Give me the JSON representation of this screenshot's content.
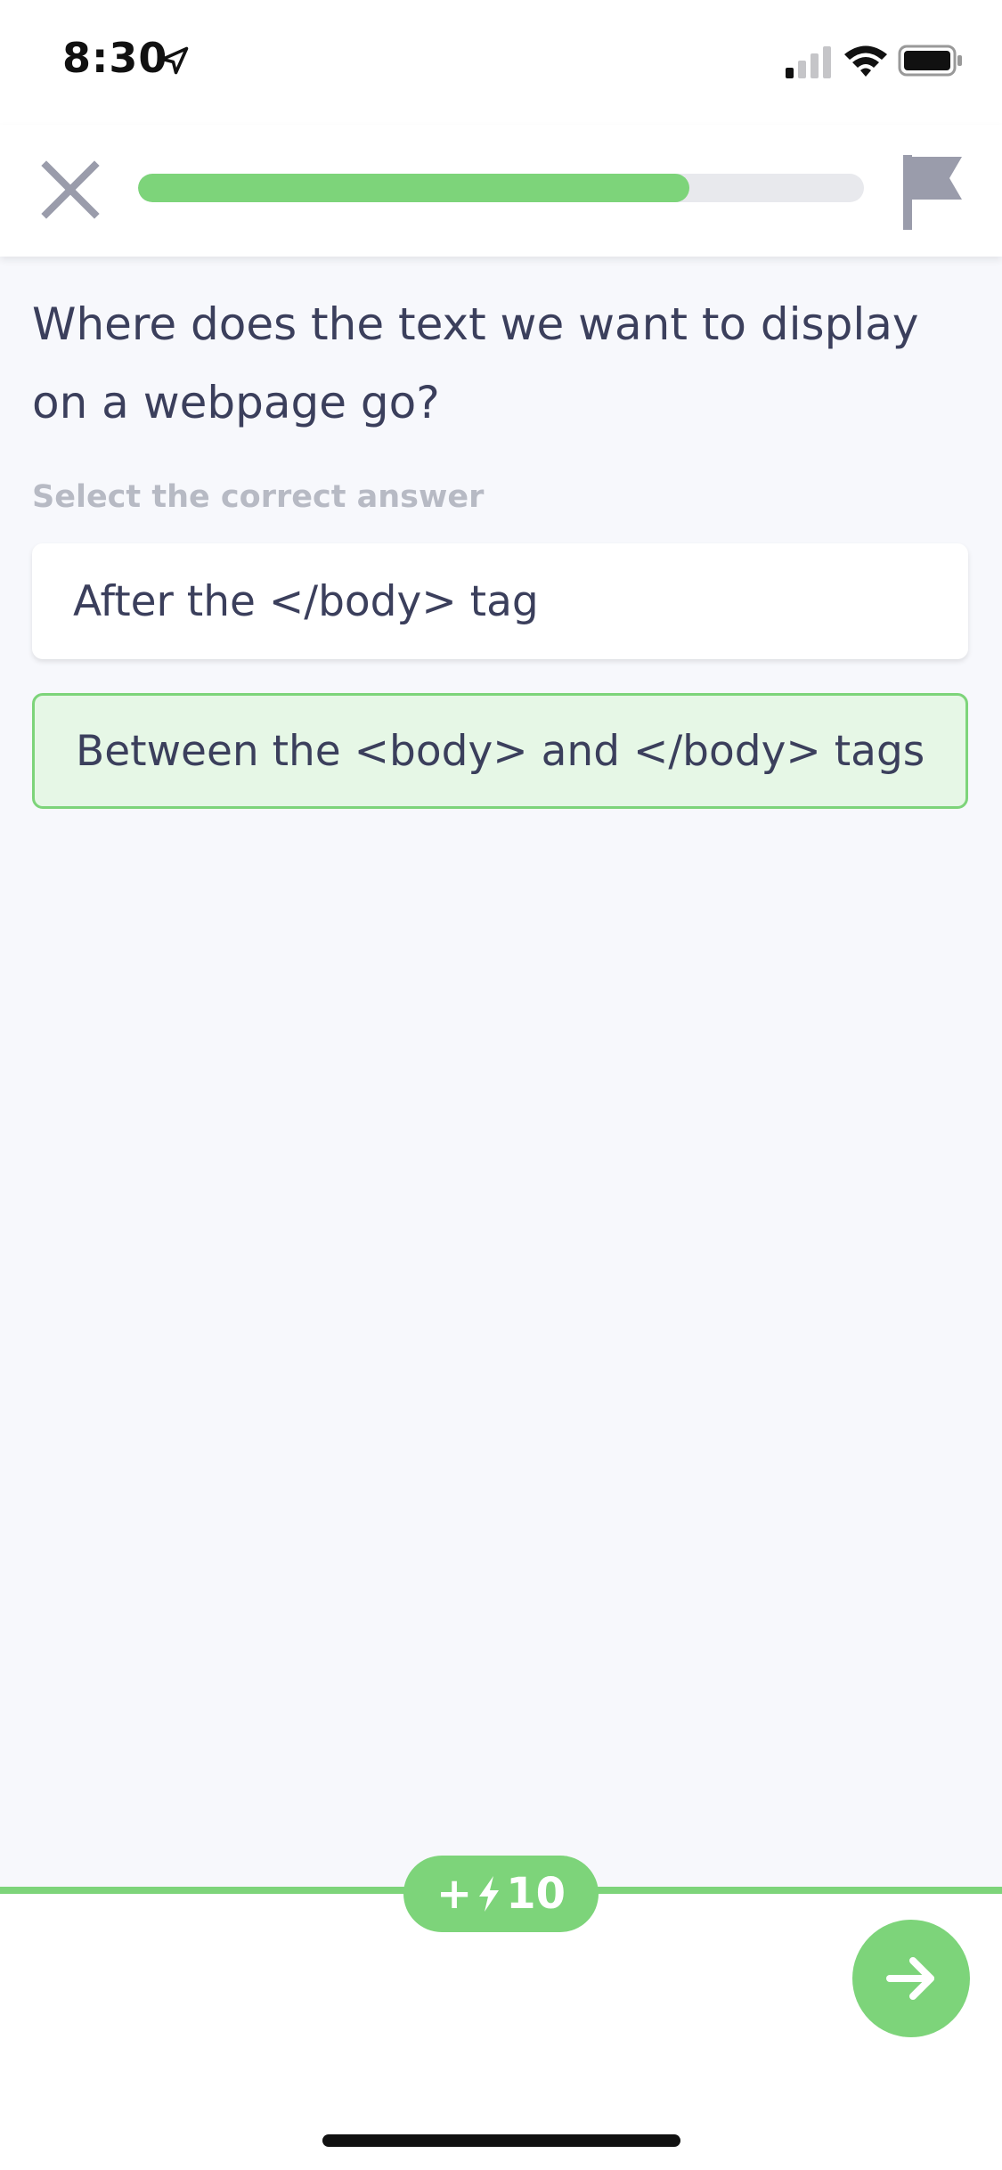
{
  "status_bar": {
    "time": "8:30"
  },
  "header": {
    "progress_fraction": 0.76
  },
  "question": {
    "text": "Where does the text we want to display on a webpage go?",
    "instruction": "Select the correct answer"
  },
  "answers": [
    {
      "label": "After the </body> tag",
      "state": "default"
    },
    {
      "label": "Between the <body> and </body> tags",
      "state": "selected"
    }
  ],
  "reward": {
    "prefix": "+",
    "amount": "10"
  },
  "colors": {
    "accent_green": "#7dd47a",
    "selected_bg": "#e6f7e6",
    "text_primary": "#3b3f5c",
    "text_muted": "#b7bac4",
    "icon_grey": "#9a9cab"
  },
  "icons": {
    "close": "close-icon",
    "flag": "flag-icon",
    "bolt": "bolt-icon",
    "next": "arrow-right-icon"
  }
}
